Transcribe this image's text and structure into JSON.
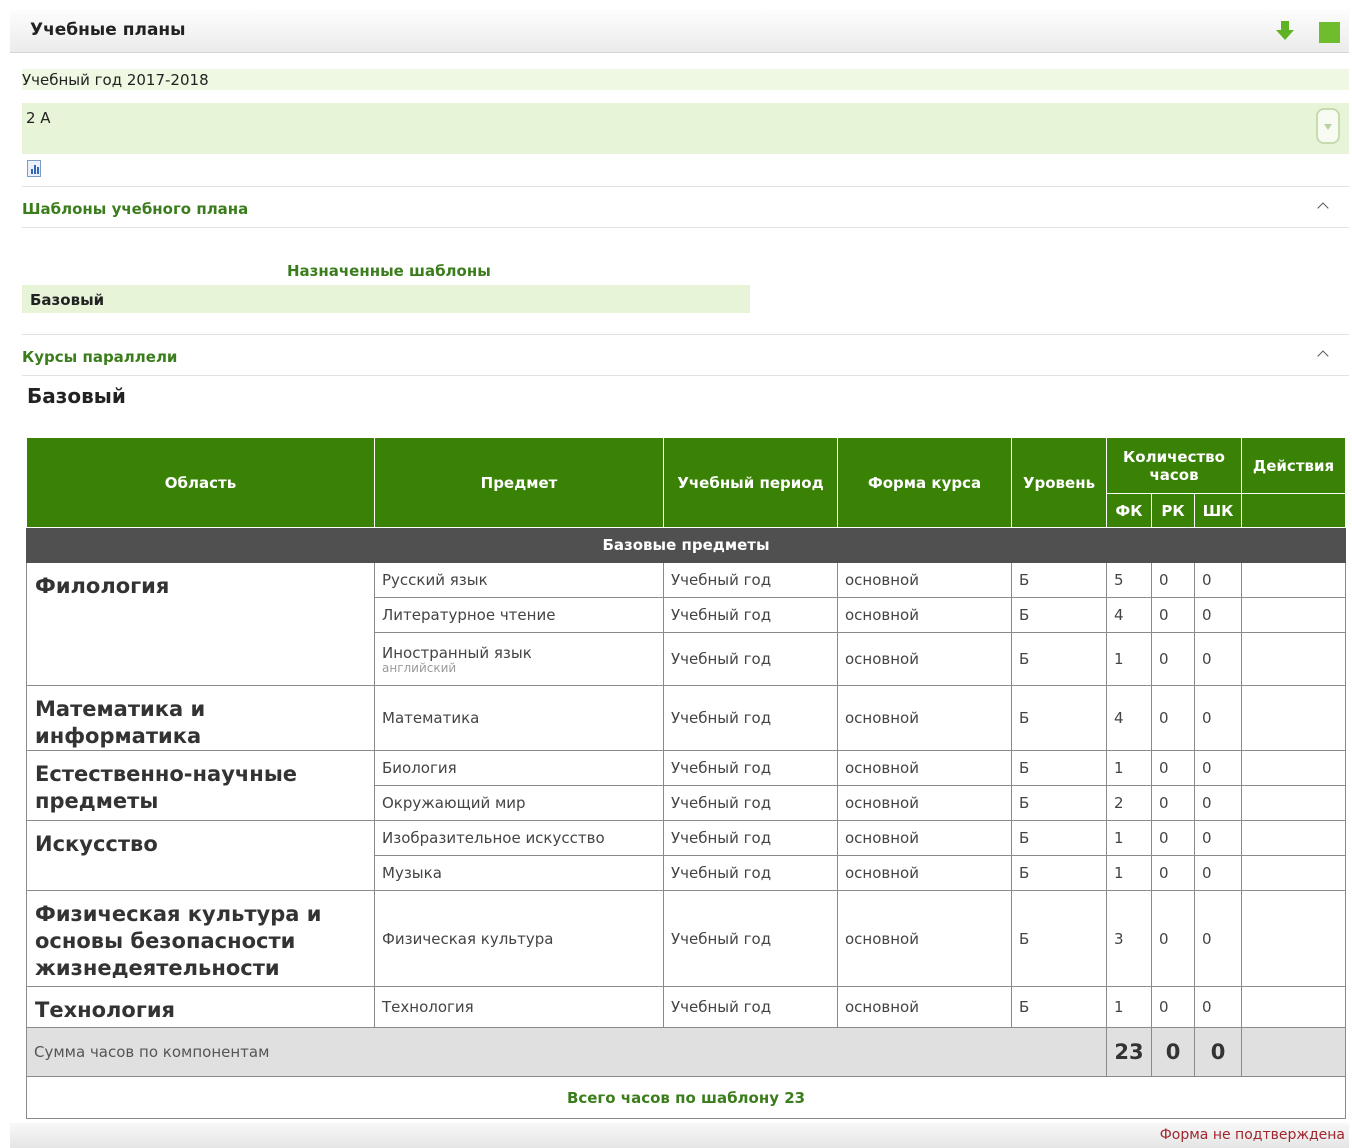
{
  "page": {
    "title": "Учебные планы"
  },
  "toolbar": {
    "download_icon": "arrow-down-icon",
    "square_icon": "green-square-icon"
  },
  "filters": {
    "year_label": "Учебный год 2017-2018",
    "class_label": "2 А"
  },
  "sections": {
    "templates_title": "Шаблоны учебного плана",
    "assigned_title": "Назначенные шаблоны",
    "assigned_items": [
      "Базовый"
    ],
    "courses_title": "Курсы параллели",
    "template_name": "Базовый"
  },
  "table": {
    "headers": {
      "area": "Область",
      "subject": "Предмет",
      "period": "Учебный период",
      "form": "Форма курса",
      "level": "Уровень",
      "hours": "Количество часов",
      "actions": "Действия",
      "fk": "ФК",
      "rk": "РК",
      "shk": "ШК"
    },
    "group_title": "Базовые предметы",
    "areas": [
      {
        "name": "Филология",
        "rows": [
          {
            "subject": "Русский язык",
            "note": "",
            "period": "Учебный год",
            "form": "основной",
            "level": "Б",
            "fk": "5",
            "rk": "0",
            "shk": "0"
          },
          {
            "subject": "Литературное чтение",
            "note": "",
            "period": "Учебный год",
            "form": "основной",
            "level": "Б",
            "fk": "4",
            "rk": "0",
            "shk": "0"
          },
          {
            "subject": "Иностранный язык",
            "note": "английский",
            "period": "Учебный год",
            "form": "основной",
            "level": "Б",
            "fk": "1",
            "rk": "0",
            "shk": "0"
          }
        ]
      },
      {
        "name": "Математика и информатика",
        "rows": [
          {
            "subject": "Математика",
            "note": "",
            "period": "Учебный год",
            "form": "основной",
            "level": "Б",
            "fk": "4",
            "rk": "0",
            "shk": "0"
          }
        ]
      },
      {
        "name": "Естественно-научные предметы",
        "rows": [
          {
            "subject": "Биология",
            "note": "",
            "period": "Учебный год",
            "form": "основной",
            "level": "Б",
            "fk": "1",
            "rk": "0",
            "shk": "0"
          },
          {
            "subject": "Окружающий мир",
            "note": "",
            "period": "Учебный год",
            "form": "основной",
            "level": "Б",
            "fk": "2",
            "rk": "0",
            "shk": "0"
          }
        ]
      },
      {
        "name": "Искусство",
        "rows": [
          {
            "subject": "Изобразительное искусство",
            "note": "",
            "period": "Учебный год",
            "form": "основной",
            "level": "Б",
            "fk": "1",
            "rk": "0",
            "shk": "0"
          },
          {
            "subject": "Музыка",
            "note": "",
            "period": "Учебный год",
            "form": "основной",
            "level": "Б",
            "fk": "1",
            "rk": "0",
            "shk": "0"
          }
        ]
      },
      {
        "name": "Физическая культура и основы безопасности жизнедеятельности",
        "rows": [
          {
            "subject": "Физическая культура",
            "note": "",
            "period": "Учебный год",
            "form": "основной",
            "level": "Б",
            "fk": "3",
            "rk": "0",
            "shk": "0"
          }
        ]
      },
      {
        "name": "Технология",
        "rows": [
          {
            "subject": "Технология",
            "note": "",
            "period": "Учебный год",
            "form": "основной",
            "level": "Б",
            "fk": "1",
            "rk": "0",
            "shk": "0"
          }
        ]
      }
    ],
    "sum_label": "Сумма часов по компонентам",
    "sum_fk": "23",
    "sum_rk": "0",
    "sum_shk": "0",
    "total_label": "Всего часов по шаблону 23"
  },
  "status": {
    "text": "Форма не подтверждена",
    "color": "#a0262e"
  },
  "colors": {
    "header_green": "#3a8206",
    "accent_green": "#3b7d1c",
    "group_gray": "#505050",
    "row_highlight": "#e7f4d7"
  }
}
